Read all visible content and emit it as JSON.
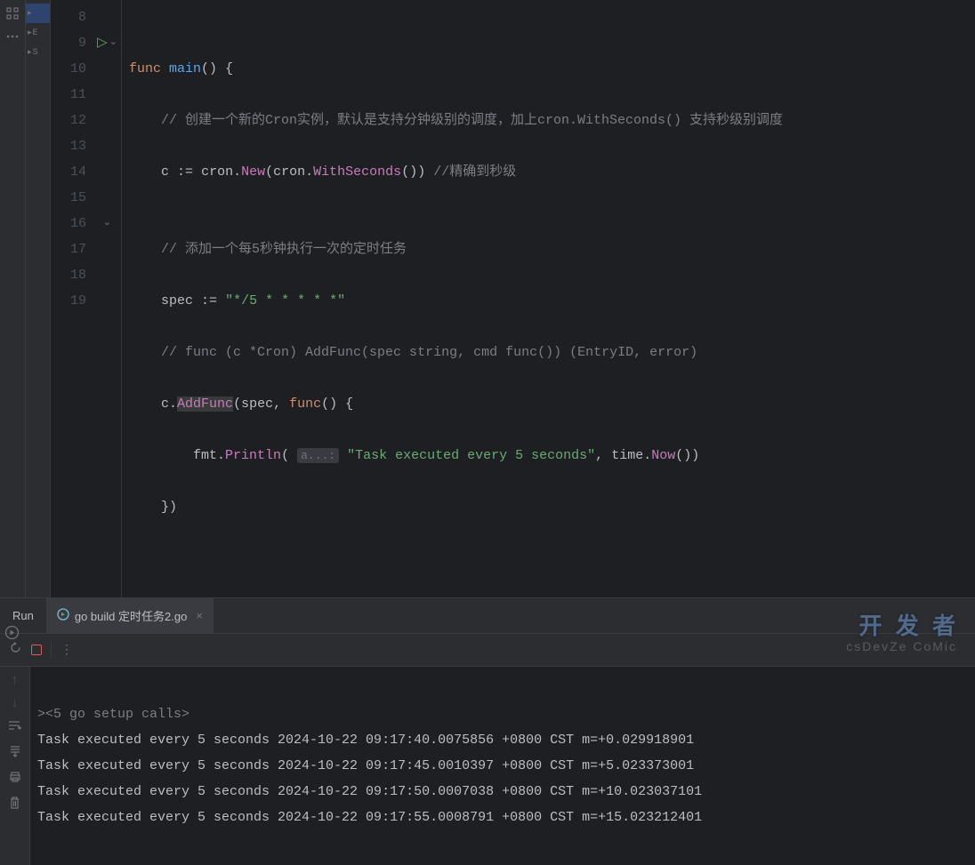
{
  "editor": {
    "lines": [
      8,
      9,
      10,
      11,
      12,
      13,
      14,
      15,
      16,
      17,
      18,
      19
    ],
    "run_line": 9,
    "fold_line": 16,
    "code": {
      "l9": {
        "k1": "func",
        "fn": "main",
        "p1": "()",
        "b1": "{"
      },
      "l10": {
        "c": "// 创建一个新的Cron实例，默认是支持分钟级别的调度，加上cron.WithSeconds() 支持秒级别调度"
      },
      "l11": {
        "v": "c",
        "op": ":=",
        "pkg": "cron",
        "dot": ".",
        "m": "New",
        "p1": "(",
        "pkg2": "cron",
        "dot2": ".",
        "m2": "WithSeconds",
        "p2": "()",
        ")": ")",
        "c": "//精确到秒级"
      },
      "l13": {
        "c": "// 添加一个每5秒钟执行一次的定时任务"
      },
      "l14": {
        "v": "spec",
        "op": ":=",
        "s": "\"*/5 * * * * *\""
      },
      "l15": {
        "c": "// func (c *Cron) AddFunc(spec string, cmd func()) (EntryID, error)"
      },
      "l16": {
        "v": "c",
        "dot": ".",
        "m": "AddFunc",
        "p1": "(",
        "a1": "spec",
        ",": ", ",
        "k": "func",
        "p2": "()",
        "b": "{"
      },
      "l17": {
        "pkg": "fmt",
        "dot": ".",
        "m": "Println",
        "p1": "(",
        "hint": "a...:",
        "s": "\"Task executed every 5 seconds\"",
        ",": ", ",
        "pkg2": "time",
        "dot2": ".",
        "m2": "Now",
        "p2": "()",
        ")": ")"
      },
      "l18": {
        "b": "}",
        ")": ")"
      }
    }
  },
  "runpanel": {
    "label": "Run",
    "tab": "go build 定时任务2.go"
  },
  "console": {
    "setup": "<5 go setup calls>",
    "lines": [
      "Task executed every 5 seconds 2024-10-22 09:17:40.0075856 +0800 CST m=+0.029918901",
      "Task executed every 5 seconds 2024-10-22 09:17:45.0010397 +0800 CST m=+5.023373001",
      "Task executed every 5 seconds 2024-10-22 09:17:50.0007038 +0800 CST m=+10.023037101",
      "Task executed every 5 seconds 2024-10-22 09:17:55.0008791 +0800 CST m=+15.023212401"
    ]
  },
  "watermark": {
    "brand": "开 发 者",
    "sub": "csDevZe CoMic",
    "side": " "
  }
}
